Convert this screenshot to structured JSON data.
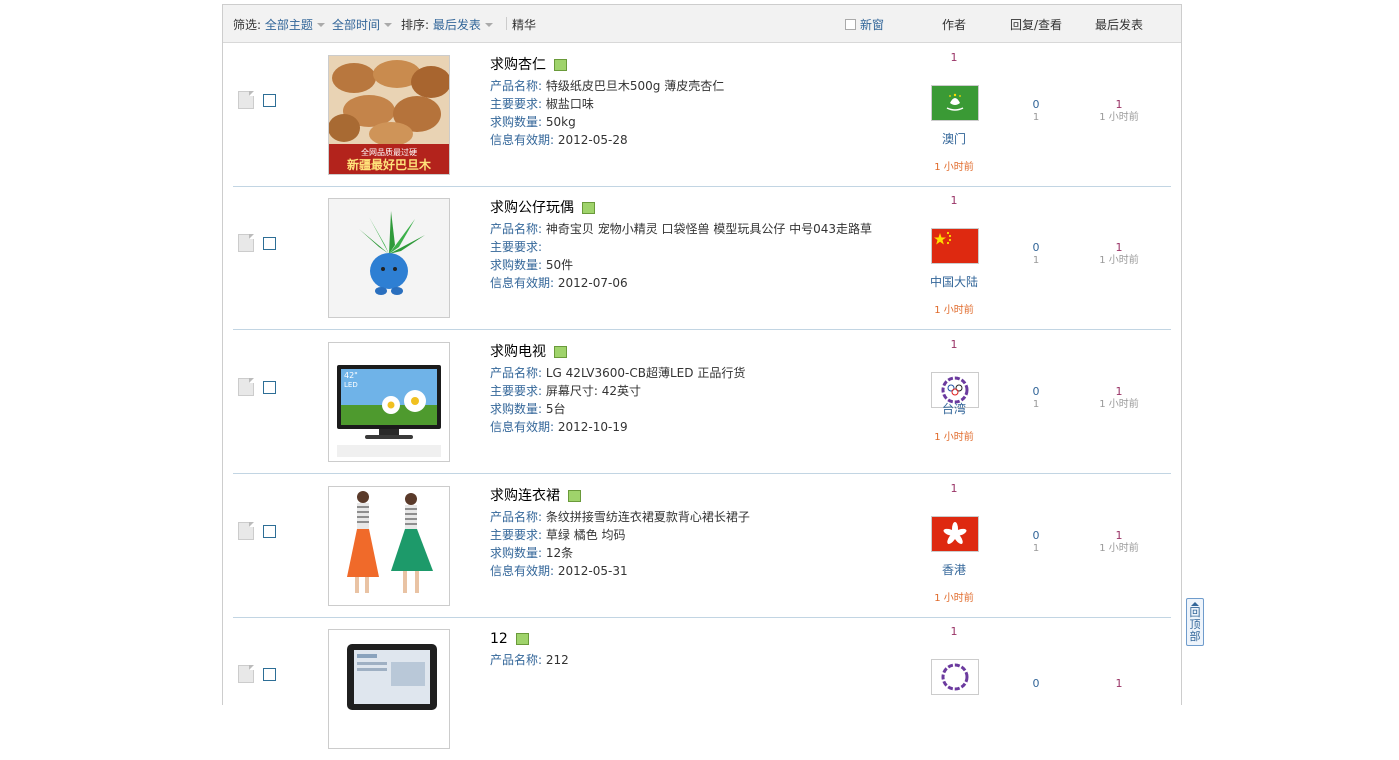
{
  "header": {
    "filter_label": "筛选:",
    "filter_value": "全部主题",
    "time_value": "全部时间",
    "sort_label": "排序:",
    "sort_value": "最后发表",
    "digest_label": "精华",
    "new_window_label": "新窗",
    "col_author": "作者",
    "col_reply": "回复/查看",
    "col_last": "最后发表"
  },
  "rows": [
    {
      "title": "求购杏仁",
      "product_label": "产品名称:",
      "product": "特级纸皮巴旦木500g 薄皮壳杏仁",
      "req_label": "主要要求:",
      "req": "椒盐口味",
      "qty_label": "求购数量:",
      "qty": "50kg",
      "valid_label": "信息有效期:",
      "valid": "2012-05-28",
      "uid": "1",
      "location": "澳门",
      "time": "1 小时前",
      "replies": "0",
      "views": "1",
      "last_user": "1",
      "last_time": "1 小时前",
      "thumb_text": [
        "全网品质最过硬",
        "新疆最好巴旦木"
      ]
    },
    {
      "title": "求购公仔玩偶",
      "product_label": "产品名称:",
      "product": "神奇宝贝 宠物小精灵 口袋怪兽 模型玩具公仔 中号043走路草",
      "req_label": "主要要求:",
      "req": "",
      "qty_label": "求购数量:",
      "qty": "50件",
      "valid_label": "信息有效期:",
      "valid": "2012-07-06",
      "uid": "1",
      "location": "中国大陆",
      "time": "1 小时前",
      "replies": "0",
      "views": "1",
      "last_user": "1",
      "last_time": "1 小时前",
      "thumb_text": []
    },
    {
      "title": "求购电视",
      "product_label": "产品名称:",
      "product": "LG 42LV3600-CB超薄LED 正品行货",
      "req_label": "主要要求:",
      "req": "屏幕尺寸: 42英寸",
      "qty_label": "求购数量:",
      "qty": "5台",
      "valid_label": "信息有效期:",
      "valid": "2012-10-19",
      "uid": "1",
      "location": "台湾",
      "time": "1 小时前",
      "replies": "0",
      "views": "1",
      "last_user": "1",
      "last_time": "1 小时前",
      "thumb_text": [
        "42\"",
        "LED"
      ]
    },
    {
      "title": "求购连衣裙",
      "product_label": "产品名称:",
      "product": "条纹拼接雪纺连衣裙夏款背心裙长裙子",
      "req_label": "主要要求:",
      "req": "草绿 橘色 均码",
      "qty_label": "求购数量:",
      "qty": "12条",
      "valid_label": "信息有效期:",
      "valid": "2012-05-31",
      "uid": "1",
      "location": "香港",
      "time": "1 小时前",
      "replies": "0",
      "views": "1",
      "last_user": "1",
      "last_time": "1 小时前",
      "thumb_text": []
    },
    {
      "title": "12",
      "product_label": "产品名称:",
      "product": "212",
      "uid": "1",
      "replies": "0",
      "last_user": "1",
      "thumb_text": []
    }
  ],
  "back_to_top": "回顶部",
  "colors": {
    "link": "#336699",
    "time": "#e06a2a",
    "border": "#c2d5e3"
  }
}
